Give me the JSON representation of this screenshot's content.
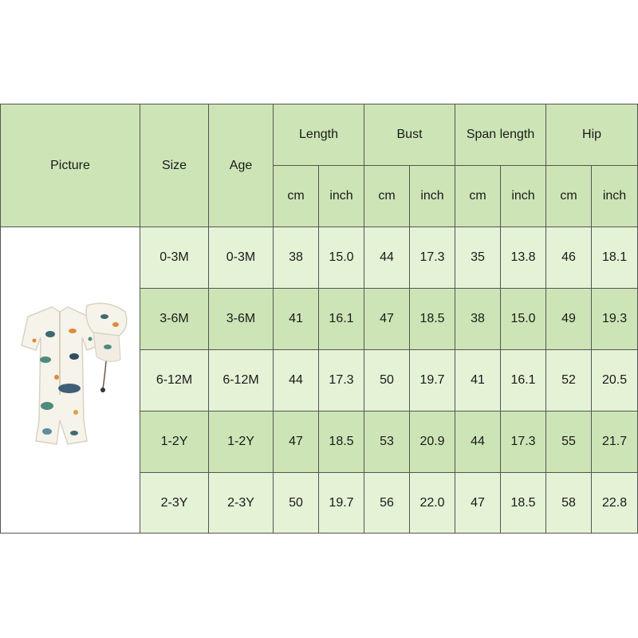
{
  "table": {
    "headers": {
      "picture": "Picture",
      "size": "Size",
      "age": "Age",
      "length": "Length",
      "bust": "Bust",
      "span_length": "Span length",
      "hip": "Hip",
      "cm": "cm",
      "inch": "inch"
    },
    "rows": [
      {
        "size": "0-3M",
        "age": "0-3M",
        "length_cm": "38",
        "length_inch": "15.0",
        "bust_cm": "44",
        "bust_inch": "17.3",
        "span_cm": "35",
        "span_inch": "13.8",
        "hip_cm": "46",
        "hip_inch": "18.1"
      },
      {
        "size": "3-6M",
        "age": "3-6M",
        "length_cm": "41",
        "length_inch": "16.1",
        "bust_cm": "47",
        "bust_inch": "18.5",
        "span_cm": "38",
        "span_inch": "15.0",
        "hip_cm": "49",
        "hip_inch": "19.3"
      },
      {
        "size": "6-12M",
        "age": "6-12M",
        "length_cm": "44",
        "length_inch": "17.3",
        "bust_cm": "50",
        "bust_inch": "19.7",
        "span_cm": "41",
        "span_inch": "16.1",
        "hip_cm": "52",
        "hip_inch": "20.5"
      },
      {
        "size": "1-2Y",
        "age": "1-2Y",
        "length_cm": "47",
        "length_inch": "18.5",
        "bust_cm": "53",
        "bust_inch": "20.9",
        "span_cm": "44",
        "span_inch": "17.3",
        "hip_cm": "55",
        "hip_inch": "21.7"
      },
      {
        "size": "2-3Y",
        "age": "2-3Y",
        "length_cm": "50",
        "length_inch": "19.7",
        "bust_cm": "56",
        "bust_inch": "22.0",
        "span_cm": "47",
        "span_inch": "18.5",
        "hip_cm": "58",
        "hip_inch": "22.8"
      }
    ]
  },
  "colors": {
    "header_green": "#cde5b6",
    "light_green": "#e4f2d6",
    "border": "#555555"
  }
}
